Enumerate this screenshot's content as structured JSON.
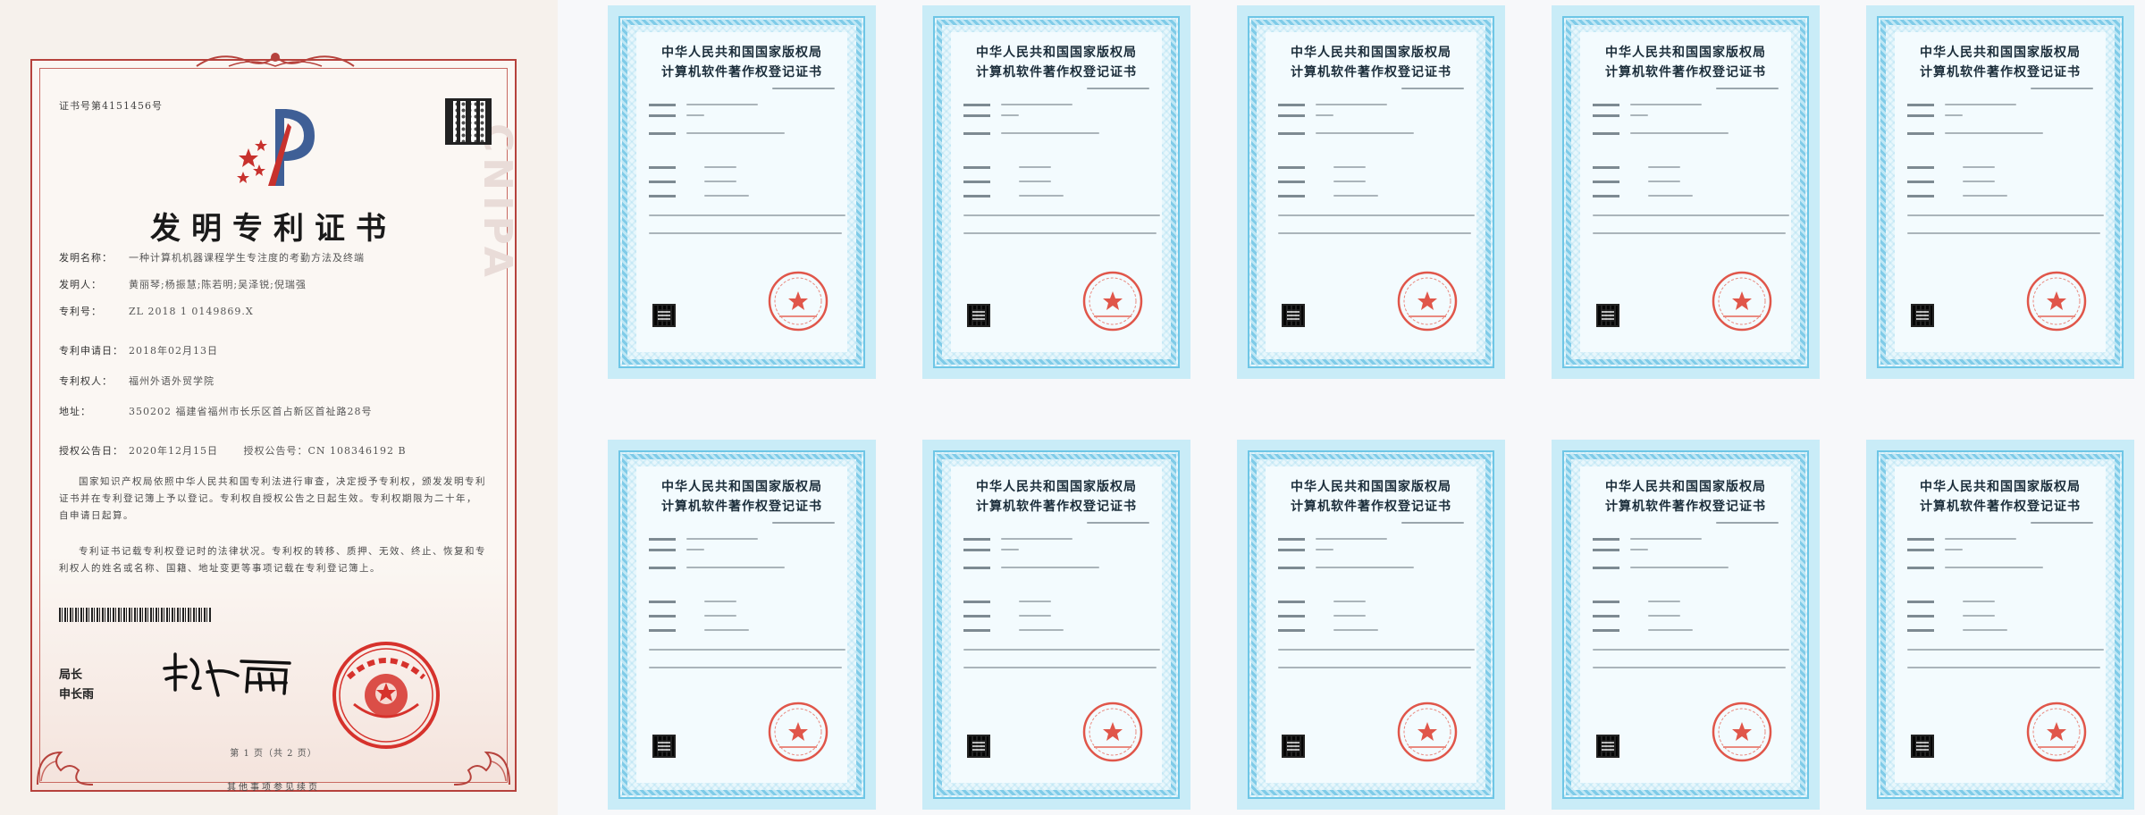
{
  "patent": {
    "watermark": "CNIPA",
    "certificate_no": "证书号第4151456号",
    "title": "发明专利证书",
    "fields": [
      {
        "label": "发明名称：",
        "value": "一种计算机机器课程学生专注度的考勤方法及终端"
      },
      {
        "label": "发明人：",
        "value": "黄丽琴;杨振慧;陈若明;吴泽锐;倪瑞强"
      },
      {
        "label": "专利号：",
        "value": "ZL 2018 1 0149869.X"
      },
      {
        "label": "专利申请日：",
        "value": "2018年02月13日"
      },
      {
        "label": "专利权人：",
        "value": "福州外语外贸学院"
      },
      {
        "label": "地址：",
        "value": "350202 福建省福州市长乐区首占新区首祉路28号"
      },
      {
        "label": "授权公告日：",
        "value": "2020年12月15日"
      }
    ],
    "pub_no": "授权公告号：CN 108346192 B",
    "paragraphs": [
      "国家知识产权局依照中华人民共和国专利法进行审查，决定授予专利权，颁发发明专利证书并在专利登记簿上予以登记。专利权自授权公告之日起生效。专利权期限为二十年，自申请日起算。",
      "专利证书记载专利权登记时的法律状况。专利权的转移、质押、无效、终止、恢复和专利权人的姓名或名称、国籍、地址变更等事项记载在专利登记簿上。"
    ],
    "director_title": "局长",
    "director_name": "申长雨",
    "page_no": "第 1 页（共 2 页）",
    "footer_note": "其他事项参见续页"
  },
  "software_certificate": {
    "line1": "中华人民共和国国家版权局",
    "line2": "计算机软件著作权登记证书",
    "count": 10
  },
  "colors": {
    "patent_border": "#b6423c",
    "seal_red": "#d6322c",
    "sw_blue": "#6ec6e6"
  }
}
